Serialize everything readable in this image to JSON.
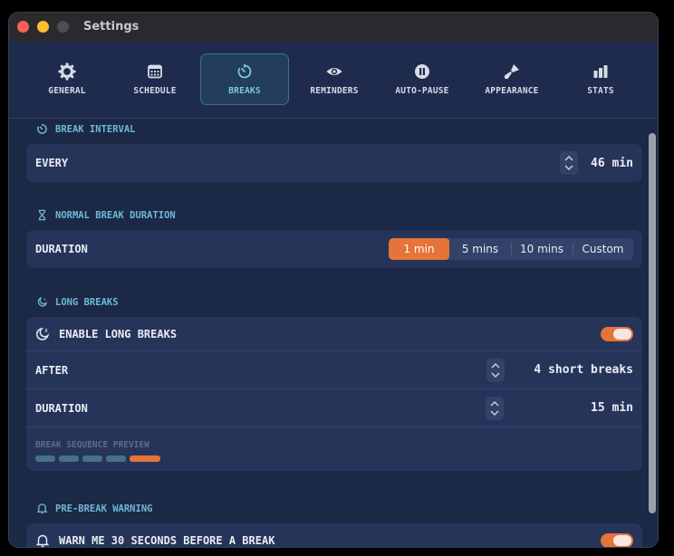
{
  "window": {
    "title": "Settings"
  },
  "tabs": [
    {
      "id": "general",
      "label": "GENERAL",
      "icon": "gear-icon"
    },
    {
      "id": "schedule",
      "label": "SCHEDULE",
      "icon": "calendar-icon"
    },
    {
      "id": "breaks",
      "label": "BREAKS",
      "icon": "timer-icon",
      "active": true
    },
    {
      "id": "reminders",
      "label": "REMINDERS",
      "icon": "eye-icon"
    },
    {
      "id": "auto-pause",
      "label": "AUTO-PAUSE",
      "icon": "pause-icon"
    },
    {
      "id": "appearance",
      "label": "APPEARANCE",
      "icon": "paintbrush-icon"
    },
    {
      "id": "stats",
      "label": "STATS",
      "icon": "bar-chart-icon"
    }
  ],
  "break_interval": {
    "heading": "BREAK INTERVAL",
    "every_label": "EVERY",
    "every_value": "46 min"
  },
  "normal_break": {
    "heading": "NORMAL BREAK DURATION",
    "duration_label": "DURATION",
    "options": [
      "1 min",
      "5 mins",
      "10 mins",
      "Custom"
    ],
    "selected": "1 min"
  },
  "long_breaks": {
    "heading": "LONG BREAKS",
    "enable_label": "ENABLE LONG BREAKS",
    "enabled": true,
    "after_label": "AFTER",
    "after_value": "4 short breaks",
    "duration_label": "DURATION",
    "duration_value": "15 min",
    "preview_label": "BREAK SEQUENCE PREVIEW",
    "sequence": [
      "short",
      "short",
      "short",
      "short",
      "long"
    ]
  },
  "pre_break": {
    "heading": "PRE-BREAK WARNING",
    "warn_label": "WARN ME 30 SECONDS BEFORE A BREAK",
    "enabled": true
  },
  "colors": {
    "accent": "#e5733a",
    "section_heading": "#6fb9d4",
    "background": "#1b2846",
    "card": "#26345a",
    "active_tab_text": "#7fc4dc"
  }
}
